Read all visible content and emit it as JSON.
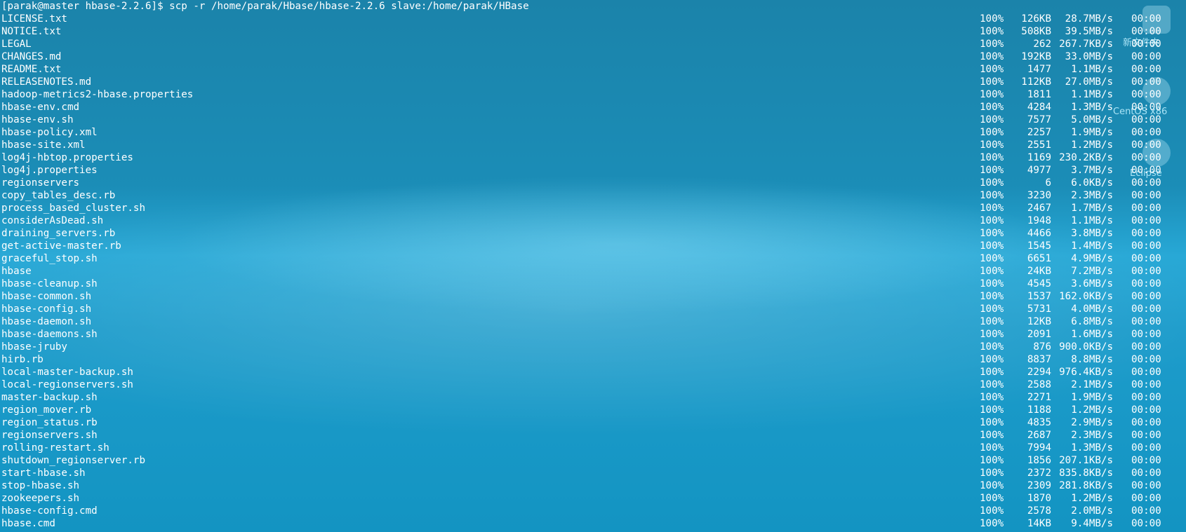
{
  "terminal": {
    "prompt": "[parak@master hbase-2.2.6]$ scp -r /home/parak/Hbase/hbase-2.2.6 slave:/home/parak/HBase",
    "rows": [
      {
        "file": "LICENSE.txt",
        "pct": "100%",
        "size": "126KB",
        "rate": "28.7MB/s",
        "time": "00:00"
      },
      {
        "file": "NOTICE.txt",
        "pct": "100%",
        "size": "508KB",
        "rate": "39.5MB/s",
        "time": "00:00"
      },
      {
        "file": "LEGAL",
        "pct": "100%",
        "size": "262",
        "rate": "267.7KB/s",
        "time": "00:00"
      },
      {
        "file": "CHANGES.md",
        "pct": "100%",
        "size": "192KB",
        "rate": "33.0MB/s",
        "time": "00:00"
      },
      {
        "file": "README.txt",
        "pct": "100%",
        "size": "1477",
        "rate": "1.1MB/s",
        "time": "00:00"
      },
      {
        "file": "RELEASENOTES.md",
        "pct": "100%",
        "size": "112KB",
        "rate": "27.0MB/s",
        "time": "00:00"
      },
      {
        "file": "hadoop-metrics2-hbase.properties",
        "pct": "100%",
        "size": "1811",
        "rate": "1.1MB/s",
        "time": "00:00"
      },
      {
        "file": "hbase-env.cmd",
        "pct": "100%",
        "size": "4284",
        "rate": "1.3MB/s",
        "time": "00:00"
      },
      {
        "file": "hbase-env.sh",
        "pct": "100%",
        "size": "7577",
        "rate": "5.0MB/s",
        "time": "00:00"
      },
      {
        "file": "hbase-policy.xml",
        "pct": "100%",
        "size": "2257",
        "rate": "1.9MB/s",
        "time": "00:00"
      },
      {
        "file": "hbase-site.xml",
        "pct": "100%",
        "size": "2551",
        "rate": "1.2MB/s",
        "time": "00:00"
      },
      {
        "file": "log4j-hbtop.properties",
        "pct": "100%",
        "size": "1169",
        "rate": "230.2KB/s",
        "time": "00:00"
      },
      {
        "file": "log4j.properties",
        "pct": "100%",
        "size": "4977",
        "rate": "3.7MB/s",
        "time": "00:00"
      },
      {
        "file": "regionservers",
        "pct": "100%",
        "size": "6",
        "rate": "6.0KB/s",
        "time": "00:00"
      },
      {
        "file": "copy_tables_desc.rb",
        "pct": "100%",
        "size": "3230",
        "rate": "2.3MB/s",
        "time": "00:00"
      },
      {
        "file": "process_based_cluster.sh",
        "pct": "100%",
        "size": "2467",
        "rate": "1.7MB/s",
        "time": "00:00"
      },
      {
        "file": "considerAsDead.sh",
        "pct": "100%",
        "size": "1948",
        "rate": "1.1MB/s",
        "time": "00:00"
      },
      {
        "file": "draining_servers.rb",
        "pct": "100%",
        "size": "4466",
        "rate": "3.8MB/s",
        "time": "00:00"
      },
      {
        "file": "get-active-master.rb",
        "pct": "100%",
        "size": "1545",
        "rate": "1.4MB/s",
        "time": "00:00"
      },
      {
        "file": "graceful_stop.sh",
        "pct": "100%",
        "size": "6651",
        "rate": "4.9MB/s",
        "time": "00:00"
      },
      {
        "file": "hbase",
        "pct": "100%",
        "size": "24KB",
        "rate": "7.2MB/s",
        "time": "00:00"
      },
      {
        "file": "hbase-cleanup.sh",
        "pct": "100%",
        "size": "4545",
        "rate": "3.6MB/s",
        "time": "00:00"
      },
      {
        "file": "hbase-common.sh",
        "pct": "100%",
        "size": "1537",
        "rate": "162.0KB/s",
        "time": "00:00"
      },
      {
        "file": "hbase-config.sh",
        "pct": "100%",
        "size": "5731",
        "rate": "4.0MB/s",
        "time": "00:00"
      },
      {
        "file": "hbase-daemon.sh",
        "pct": "100%",
        "size": "12KB",
        "rate": "6.8MB/s",
        "time": "00:00"
      },
      {
        "file": "hbase-daemons.sh",
        "pct": "100%",
        "size": "2091",
        "rate": "1.6MB/s",
        "time": "00:00"
      },
      {
        "file": "hbase-jruby",
        "pct": "100%",
        "size": "876",
        "rate": "900.0KB/s",
        "time": "00:00"
      },
      {
        "file": "hirb.rb",
        "pct": "100%",
        "size": "8837",
        "rate": "8.8MB/s",
        "time": "00:00"
      },
      {
        "file": "local-master-backup.sh",
        "pct": "100%",
        "size": "2294",
        "rate": "976.4KB/s",
        "time": "00:00"
      },
      {
        "file": "local-regionservers.sh",
        "pct": "100%",
        "size": "2588",
        "rate": "2.1MB/s",
        "time": "00:00"
      },
      {
        "file": "master-backup.sh",
        "pct": "100%",
        "size": "2271",
        "rate": "1.9MB/s",
        "time": "00:00"
      },
      {
        "file": "region_mover.rb",
        "pct": "100%",
        "size": "1188",
        "rate": "1.2MB/s",
        "time": "00:00"
      },
      {
        "file": "region_status.rb",
        "pct": "100%",
        "size": "4835",
        "rate": "2.9MB/s",
        "time": "00:00"
      },
      {
        "file": "regionservers.sh",
        "pct": "100%",
        "size": "2687",
        "rate": "2.3MB/s",
        "time": "00:00"
      },
      {
        "file": "rolling-restart.sh",
        "pct": "100%",
        "size": "7994",
        "rate": "1.3MB/s",
        "time": "00:00"
      },
      {
        "file": "shutdown_regionserver.rb",
        "pct": "100%",
        "size": "1856",
        "rate": "207.1KB/s",
        "time": "00:00"
      },
      {
        "file": "start-hbase.sh",
        "pct": "100%",
        "size": "2372",
        "rate": "835.8KB/s",
        "time": "00:00"
      },
      {
        "file": "stop-hbase.sh",
        "pct": "100%",
        "size": "2309",
        "rate": "281.8KB/s",
        "time": "00:00"
      },
      {
        "file": "zookeepers.sh",
        "pct": "100%",
        "size": "1870",
        "rate": "1.2MB/s",
        "time": "00:00"
      },
      {
        "file": "hbase-config.cmd",
        "pct": "100%",
        "size": "2578",
        "rate": "2.0MB/s",
        "time": "00:00"
      },
      {
        "file": "hbase.cmd",
        "pct": "100%",
        "size": "14KB",
        "rate": "9.4MB/s",
        "time": "00:00"
      }
    ]
  },
  "desktop_icons": [
    {
      "label": "新文件夹",
      "icon": "folder-icon"
    },
    {
      "label": "CentOS x86",
      "icon": "disc-icon"
    },
    {
      "label": "Eclipse",
      "icon": "eclipse-icon"
    }
  ]
}
